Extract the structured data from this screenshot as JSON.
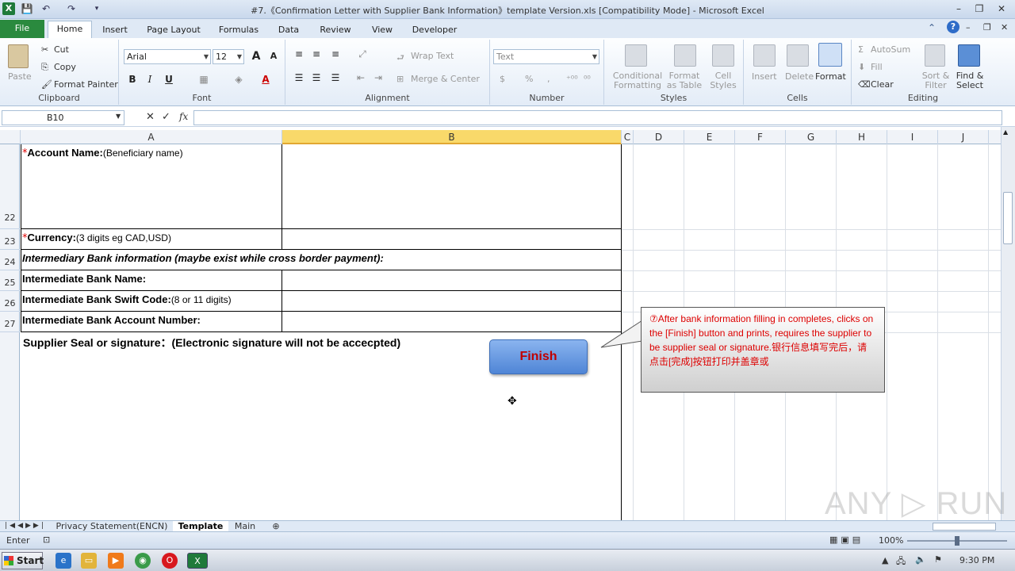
{
  "window": {
    "title": "#7.《Confirmation Letter with Supplier Bank Information》template Version.xls  [Compatibility Mode]  -  Microsoft Excel",
    "app_icon": "X",
    "minimize": "–",
    "maximize": "❐",
    "close": "✕"
  },
  "ribbon_tabs": [
    "File",
    "Home",
    "Insert",
    "Page Layout",
    "Formulas",
    "Data",
    "Review",
    "View",
    "Developer"
  ],
  "ribbon": {
    "clipboard": {
      "paste": "Paste",
      "cut": "Cut",
      "copy": "Copy",
      "format_painter": "Format Painter",
      "label": "Clipboard"
    },
    "font": {
      "name": "Arial",
      "size": "12",
      "bold": "B",
      "italic": "I",
      "underline": "U",
      "label": "Font",
      "grow": "A",
      "shrink": "A"
    },
    "alignment": {
      "wrap": "Wrap Text",
      "merge": "Merge & Center",
      "label": "Alignment"
    },
    "number": {
      "format": "Text",
      "currency": "$",
      "percent": "%",
      "comma": ",",
      "label": "Number"
    },
    "styles": {
      "conditional": "Conditional Formatting",
      "format_table": "Format as Table",
      "cell_styles": "Cell Styles",
      "label": "Styles"
    },
    "cells": {
      "insert": "Insert",
      "delete": "Delete",
      "format": "Format",
      "label": "Cells"
    },
    "editing": {
      "autosum": "AutoSum",
      "fill": "Fill",
      "clear": "Clear",
      "sort": "Sort & Filter",
      "find": "Find & Select",
      "label": "Editing"
    }
  },
  "formula_bar": {
    "name_box": "B10",
    "fx": "fx",
    "cancel": "✕",
    "enter": "✓",
    "value": ""
  },
  "columns": [
    "A",
    "B",
    "C",
    "D",
    "E",
    "F",
    "G",
    "H",
    "I",
    "J"
  ],
  "rows": [
    "22",
    "23",
    "24",
    "25",
    "26",
    "27"
  ],
  "cells": {
    "r22_star": "*",
    "r22_bold": "Account Name:",
    "r22_note": "(Beneficiary name)",
    "r23_star": "*",
    "r23_bold": "Currency:",
    "r23_note": "(3 digits eg CAD,USD)",
    "r24": "Intermediary Bank information (maybe exist while cross border payment):",
    "r25": "Intermediate Bank Name:",
    "r26_bold": "Intermediate Bank Swift Code:",
    "r26_note": "(8 or 11 digits)",
    "r27": "Intermediate Bank Account Number:",
    "r28": "Supplier Seal or signature：(Electronic signature will not be accecpted)"
  },
  "finish_button": "Finish",
  "callout": {
    "line1": "⑦After bank information filling in completes, clicks on the [Finish] button and prints, requires the supplier to be supplier seal or signature.银行信息填写完后，请点击[完成]按钮打印并盖章或"
  },
  "sheet_tabs": [
    "Privacy Statement(ENCN)",
    "Template",
    "Main"
  ],
  "active_sheet": "Template",
  "status": {
    "mode": "Enter",
    "zoom": "100%"
  },
  "taskbar": {
    "start": "Start",
    "time": "9:30 PM"
  },
  "watermark": "ANY ▷ RUN"
}
